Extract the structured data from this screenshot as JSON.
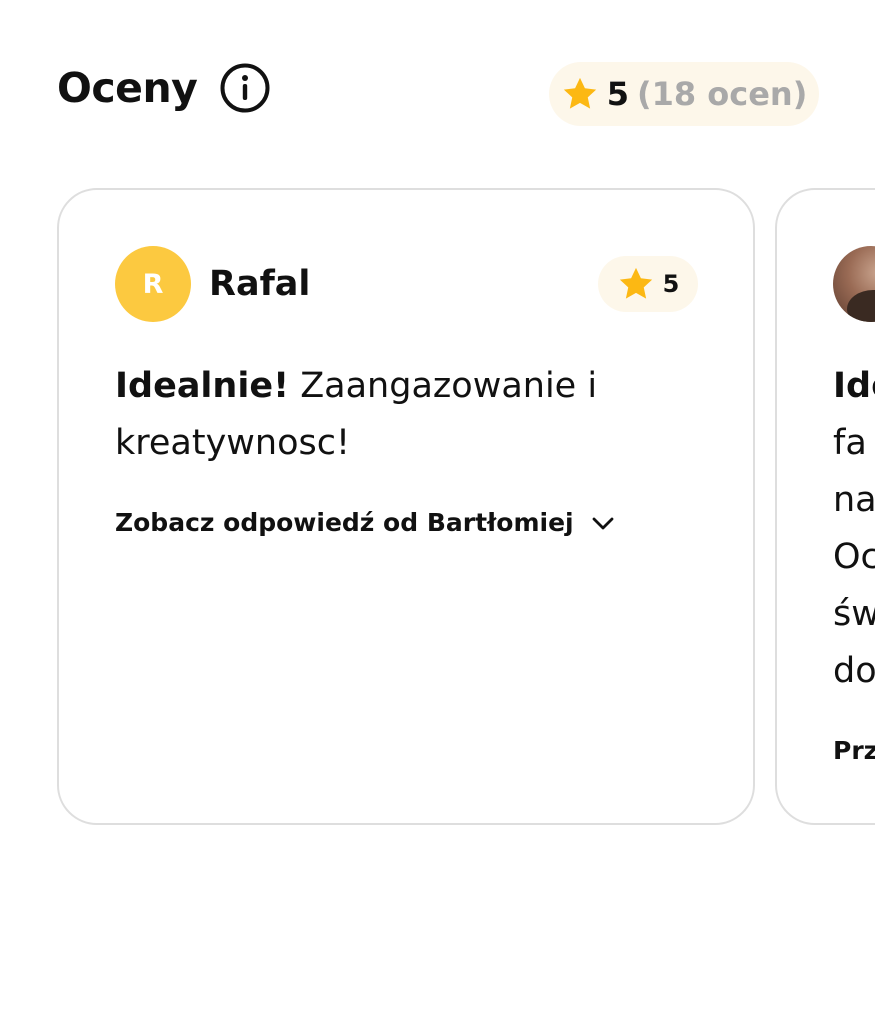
{
  "header": {
    "title": "Oceny",
    "info_icon": "info-icon"
  },
  "summary": {
    "rating": "5",
    "count_text": "(18 ocen)",
    "star_icon": "star-icon",
    "star_color": "#fcb813",
    "pill_color": "#fdf7ea"
  },
  "reviews": [
    {
      "reviewer_initial": "R",
      "reviewer_name": "Rafal",
      "avatar_color": "#fcc940",
      "rating": "5",
      "headline": "Idealnie!",
      "body": "Zaangazowanie i kreatywnosc!",
      "reply_toggle": "Zobacz odpowiedź od Bartłomiej",
      "reply_icon": "chevron-down-icon"
    },
    {
      "avatar_icon": "user-photo",
      "lines": [
        "Ide",
        "fa",
        "na",
        "Oc",
        "św",
        "do"
      ],
      "reply_toggle": "Prz"
    }
  ]
}
